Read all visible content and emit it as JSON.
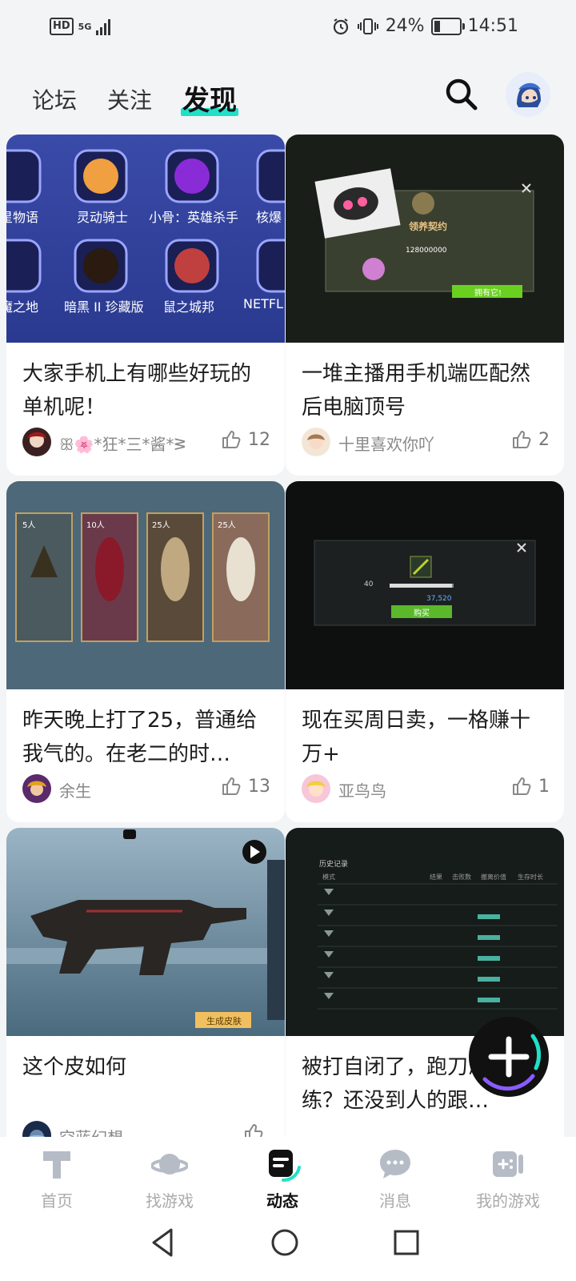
{
  "status_bar": {
    "left_badge": "HD",
    "network": "5G",
    "battery_percent": "24%",
    "time": "14:51"
  },
  "top_nav": {
    "tabs": [
      {
        "label": "论坛",
        "active": false
      },
      {
        "label": "关注",
        "active": false
      },
      {
        "label": "发现",
        "active": true
      }
    ],
    "accent_color": "#20e0c8"
  },
  "cards": [
    {
      "title": "大家手机上有哪些好玩的单机呢！",
      "author": "ꕥ🌸*狂*三*酱*ᕒ",
      "likes": "12",
      "thumb_labels": [
        "星物语",
        "灵动骑士",
        "小骨：英雄杀手",
        "核爆",
        "魔之地",
        "暗黑 II 珍藏版",
        "鼠之城邦",
        "NETFL"
      ]
    },
    {
      "title": "一堆主播用手机端匹配然后电脑顶号",
      "author": "十里喜欢你吖",
      "likes": "2",
      "thumb_labels": [
        "领养契约",
        "128000000",
        "拥有它!"
      ]
    },
    {
      "title": "昨天晚上打了25，普通给我气的。在老二的时…",
      "author": "余生",
      "likes": "13",
      "thumb_labels": [
        "5人",
        "10人",
        "25人",
        "25人"
      ]
    },
    {
      "title": "现在买周日卖，一格赚十万+",
      "author": "亚鸟鸟",
      "likes": "1",
      "thumb_labels": [
        "40",
        "37,520",
        "购买"
      ]
    },
    {
      "title": "这个皮如何",
      "author": "空蓝幻想",
      "likes": "",
      "thumb_labels": [
        "生成皮肤"
      ]
    },
    {
      "title": "被打自闭了，跑刀怎么练？还没到人的跟…",
      "author": "",
      "likes": "",
      "thumb_labels": [
        "历史记录",
        "模式",
        "结果",
        "击败数",
        "撤离价值",
        "生存时长"
      ]
    }
  ],
  "bottom_nav": {
    "items": [
      {
        "label": "首页",
        "icon": "home-t-icon",
        "active": false
      },
      {
        "label": "找游戏",
        "icon": "planet-icon",
        "active": false
      },
      {
        "label": "动态",
        "icon": "feed-icon",
        "active": true
      },
      {
        "label": "消息",
        "icon": "chat-bubble-icon",
        "active": false
      },
      {
        "label": "我的游戏",
        "icon": "gamepad-icon",
        "active": false
      }
    ]
  },
  "fab": {
    "icon": "plus-icon"
  }
}
